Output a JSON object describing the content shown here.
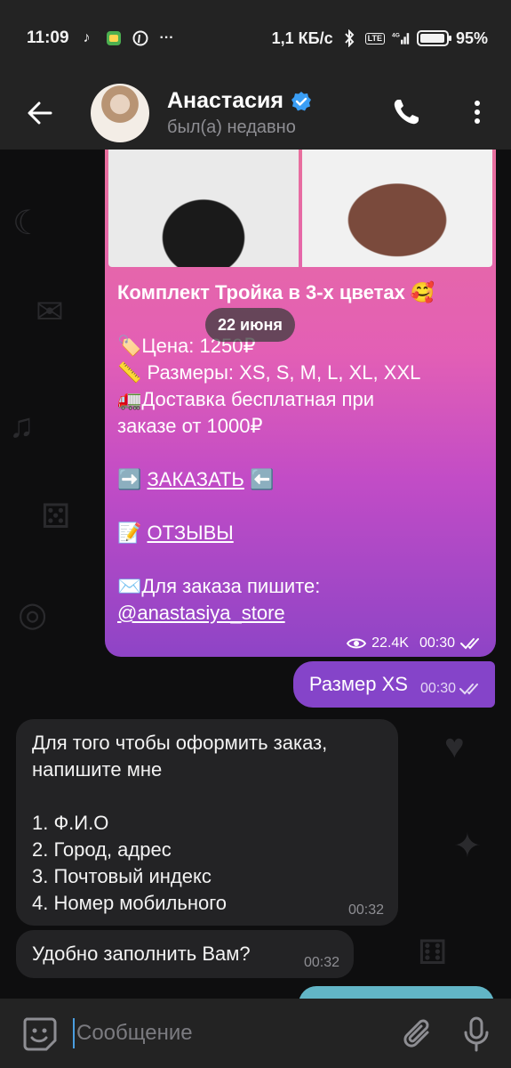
{
  "status_bar": {
    "time": "11:09",
    "speed": "1,1 КБ/с",
    "network": "4G",
    "lte": "LTE",
    "battery": "95%",
    "battery_level": 0.95,
    "icons": [
      "tiktok-icon",
      "app-icon",
      "pinterest-icon",
      "more-notifications-icon",
      "bluetooth-icon",
      "signal-icon",
      "battery-icon"
    ]
  },
  "header": {
    "name": "Анастасия",
    "status": "был(а) недавно",
    "colors": {
      "background": "#232323",
      "verified": "#3a9ef5"
    }
  },
  "chat": {
    "date_chip": "22 июня",
    "post": {
      "title": "Комплект Тройка в 3-х цветах 🥰",
      "price": "🏷️Цена: 1250₽",
      "sizes": "📏 Размеры: XS, S, M, L, XL, XXL",
      "delivery_1": "🚛Доставка бесплатная при",
      "delivery_2": "заказе от 1000₽",
      "order_prefix": "➡️ ",
      "order_link": "ЗАКАЗАТЬ",
      "order_suffix": " ⬅️",
      "reviews_prefix": "📝 ",
      "reviews_link": "ОТЗЫВЫ",
      "contact": "✉️Для заказа пишите:",
      "contact_link": "@anastasiya_store",
      "views": "22.4K",
      "time": "00:30"
    },
    "outgoing": {
      "text": "Размер XS",
      "time": "00:30"
    },
    "incoming_1": {
      "lines": [
        "Для того чтобы оформить заказ,",
        "напишите мне",
        "",
        "1. Ф.И.О",
        "2. Город, адрес",
        "3. Почтовый индекс",
        "4. Номер мобильного"
      ],
      "time": "00:32"
    },
    "incoming_2": {
      "text": "Удобно заполнить Вам?",
      "time": "00:32"
    }
  },
  "input": {
    "placeholder": "Сообщение"
  }
}
